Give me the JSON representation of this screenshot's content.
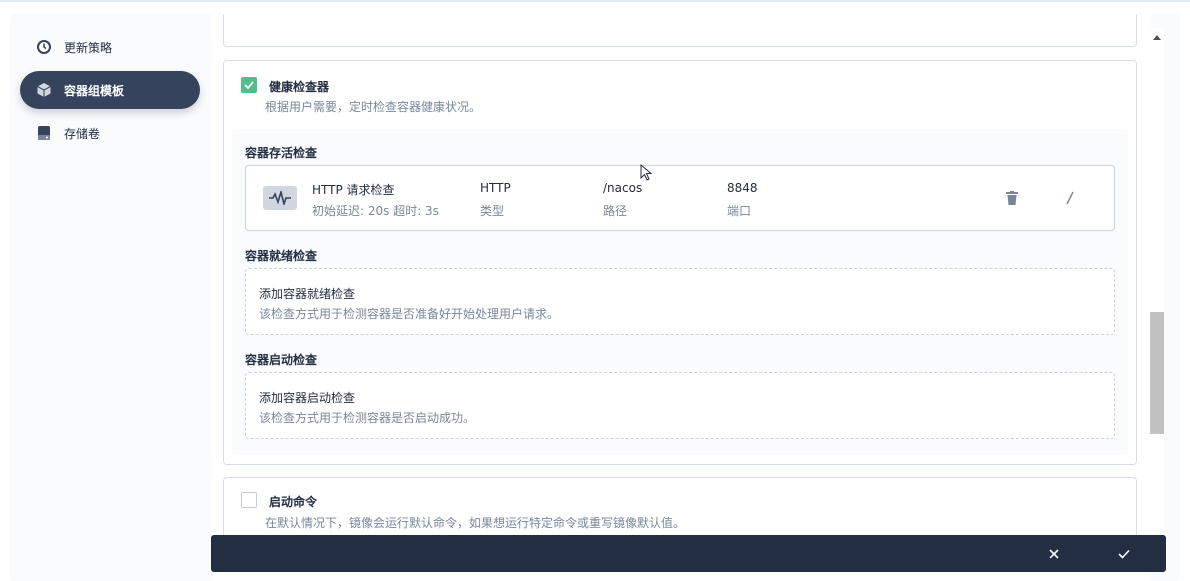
{
  "sidebar": {
    "items": [
      {
        "label": "更新策略",
        "icon": "clock-icon",
        "active": false
      },
      {
        "label": "容器组模板",
        "icon": "cube-icon",
        "active": true
      },
      {
        "label": "存储卷",
        "icon": "disk-icon",
        "active": false
      }
    ]
  },
  "health": {
    "checked": true,
    "title": "健康检查器",
    "desc": "根据用户需要，定时检查容器健康状况。",
    "liveness": {
      "title": "容器存活检查",
      "probe": {
        "name": "HTTP 请求检查",
        "meta": "初始延迟: 20s  超时: 3s",
        "type_value": "HTTP",
        "type_label": "类型",
        "path_value": "/nacos",
        "path_label": "路径",
        "port_value": "8848",
        "port_label": "端口"
      }
    },
    "readiness": {
      "title": "容器就绪检查",
      "add_title": "添加容器就绪检查",
      "add_desc": "该检查方式用于检测容器是否准备好开始处理用户请求。"
    },
    "startup": {
      "title": "容器启动检查",
      "add_title": "添加容器启动检查",
      "add_desc": "该检查方式用于检测容器是否启动成功。"
    }
  },
  "start_command": {
    "checked": false,
    "title": "启动命令",
    "desc": "在默认情况下，镜像会运行默认命令，如果想运行特定命令或重写镜像默认值。"
  },
  "footer": {
    "cancel_icon": "close-icon",
    "confirm_icon": "check-icon"
  },
  "colors": {
    "dark": "#242e42",
    "active_nav": "#36435c",
    "green": "#55bc8a",
    "muted": "#79879c"
  }
}
